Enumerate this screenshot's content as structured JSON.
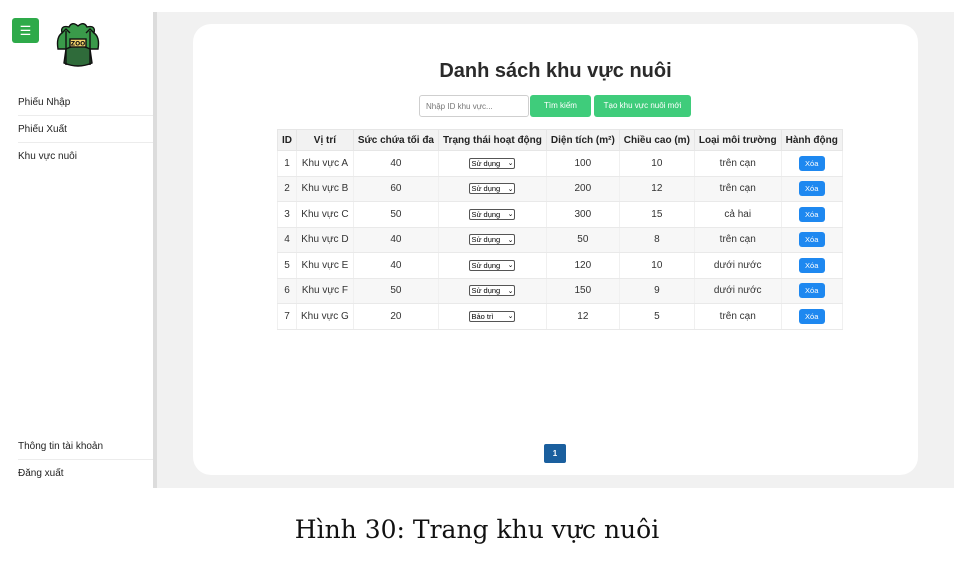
{
  "sidebar": {
    "menu_icon": "☰",
    "logo_text": "ZOO",
    "items": [
      {
        "label": "Phiếu Nhập"
      },
      {
        "label": "Phiếu Xuất"
      },
      {
        "label": "Khu vực nuôi"
      }
    ],
    "bottom_items": [
      {
        "label": "Thông tin tài khoản"
      },
      {
        "label": "Đăng xuất"
      }
    ]
  },
  "main": {
    "title": "Danh sách khu vực nuôi",
    "search": {
      "placeholder": "Nhập ID khu vực...",
      "value": ""
    },
    "search_button": "Tìm kiếm",
    "create_button": "Tạo khu vực nuôi mới",
    "table": {
      "headers": [
        "ID",
        "Vị trí",
        "Sức chứa tối đa",
        "Trạng thái hoạt động",
        "Diện tích (m²)",
        "Chiều cao (m)",
        "Loại môi trường",
        "Hành động"
      ],
      "rows": [
        {
          "id": "1",
          "location": "Khu vực A",
          "capacity": "40",
          "status": "Sử dụng",
          "area": "100",
          "height": "10",
          "env": "trên cạn",
          "action": "Xóa"
        },
        {
          "id": "2",
          "location": "Khu vực B",
          "capacity": "60",
          "status": "Sử dụng",
          "area": "200",
          "height": "12",
          "env": "trên cạn",
          "action": "Xóa"
        },
        {
          "id": "3",
          "location": "Khu vực C",
          "capacity": "50",
          "status": "Sử dụng",
          "area": "300",
          "height": "15",
          "env": "cả hai",
          "action": "Xóa"
        },
        {
          "id": "4",
          "location": "Khu vực D",
          "capacity": "40",
          "status": "Sử dụng",
          "area": "50",
          "height": "8",
          "env": "trên cạn",
          "action": "Xóa"
        },
        {
          "id": "5",
          "location": "Khu vực E",
          "capacity": "40",
          "status": "Sử dụng",
          "area": "120",
          "height": "10",
          "env": "dưới nước",
          "action": "Xóa"
        },
        {
          "id": "6",
          "location": "Khu vực F",
          "capacity": "50",
          "status": "Sử dụng",
          "area": "150",
          "height": "9",
          "env": "dưới nước",
          "action": "Xóa"
        },
        {
          "id": "7",
          "location": "Khu vực G",
          "capacity": "20",
          "status": "Bảo trì",
          "area": "12",
          "height": "5",
          "env": "trên cạn",
          "action": "Xóa"
        }
      ]
    },
    "pagination": {
      "current_page": "1"
    }
  },
  "caption": "Hình 30: Trang khu vực nuôi",
  "colors": {
    "green": "#3fcc7b",
    "menu_green": "#2eaa4a",
    "blue": "#1e88f0",
    "page_blue": "#1a5f9e"
  }
}
